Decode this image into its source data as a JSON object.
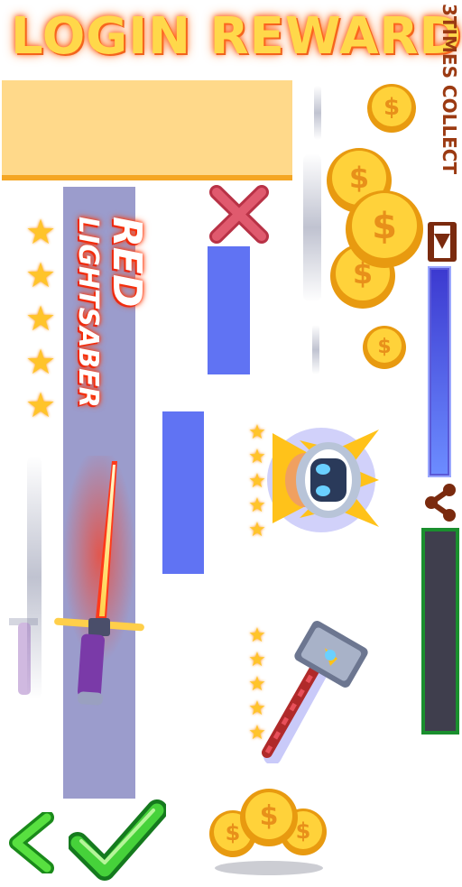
{
  "header": {
    "title": "LOGIN REWARD",
    "side_label": "3TIMES COLLECT"
  },
  "reward": {
    "name_line1": "RED",
    "name_line2": "LIGHTSABER",
    "stars": 5
  },
  "items": [
    {
      "name": "helmet",
      "stars": 5
    },
    {
      "name": "hammer",
      "stars": 5
    }
  ],
  "icons": {
    "close": "close-icon",
    "video": "video-icon",
    "share": "share-icon",
    "back": "chevron-left-icon",
    "confirm": "check-icon",
    "coin": "coin-icon"
  },
  "colors": {
    "title": "#ffd84a",
    "side_label": "#9b3a12",
    "panel": "#ffd98a",
    "lavender": "#9b9ccc",
    "blue": "#6073f3",
    "confirm_green": "#37c836",
    "close_red": "#e04a5e"
  },
  "progress": {
    "fill_fraction": 1.0
  }
}
